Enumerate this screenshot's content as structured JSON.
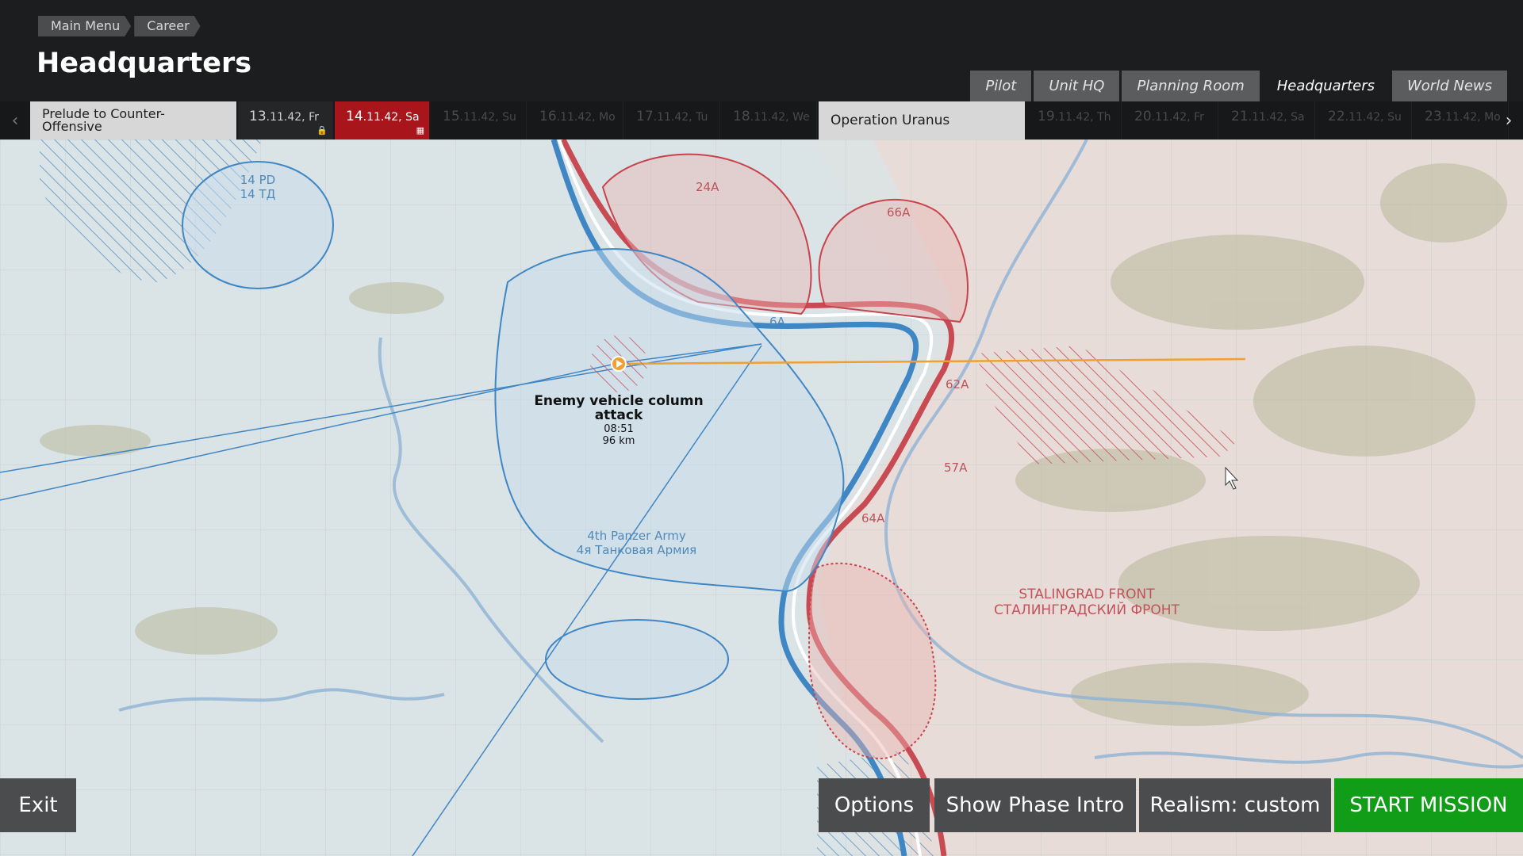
{
  "breadcrumb": [
    "Main Menu",
    "Career"
  ],
  "page_title": "Headquarters",
  "top_tabs": [
    {
      "label": "Pilot",
      "active": false
    },
    {
      "label": "Unit HQ",
      "active": false
    },
    {
      "label": "Planning Room",
      "active": false
    },
    {
      "label": "Headquarters",
      "active": true
    },
    {
      "label": "World News",
      "active": false
    }
  ],
  "timeline": {
    "phase1": "Prelude to Counter-Offensive",
    "phase2": "Operation Uranus",
    "days": [
      {
        "num": "13",
        "rest": ".11.42, Fr",
        "state": "played"
      },
      {
        "num": "14",
        "rest": ".11.42, Sa",
        "state": "current"
      },
      {
        "num": "15",
        "rest": ".11.42, Su",
        "state": "future"
      },
      {
        "num": "16",
        "rest": ".11.42, Mo",
        "state": "future"
      },
      {
        "num": "17",
        "rest": ".11.42, Tu",
        "state": "future"
      },
      {
        "num": "18",
        "rest": ".11.42, We",
        "state": "future"
      },
      {
        "num": "19",
        "rest": ".11.42, Th",
        "state": "future"
      },
      {
        "num": "20",
        "rest": ".11.42, Fr",
        "state": "future"
      },
      {
        "num": "21",
        "rest": ".11.42, Sa",
        "state": "future"
      },
      {
        "num": "22",
        "rest": ".11.42, Su",
        "state": "future"
      },
      {
        "num": "23",
        "rest": ".11.42, Mo",
        "state": "future"
      }
    ]
  },
  "map": {
    "labels": {
      "pd14_a": "14 PD",
      "pd14_b": "14 ТД",
      "a24": "24A",
      "a66": "66A",
      "a6": "6A",
      "a62": "62A",
      "a57": "57A",
      "a64": "64A",
      "panzer_a": "4th Panzer Army",
      "panzer_b": "4я Танковая Армия",
      "front_a": "STALINGRAD FRONT",
      "front_b": "СТАЛИНГРАДСКИЙ ФРОНТ"
    },
    "mission": {
      "title": "Enemy vehicle column attack",
      "time": "08:51",
      "distance": "96 km"
    },
    "colors": {
      "friendly": "#3f86c4",
      "enemy": "#c8434b",
      "route": "#f0a030"
    }
  },
  "buttons": {
    "exit": "Exit",
    "options": "Options",
    "show_phase_intro": "Show Phase Intro",
    "realism": "Realism: custom",
    "start_mission": "START MISSION"
  },
  "button_colors": {
    "default": "#4a4c4e",
    "start": "#129d19"
  }
}
